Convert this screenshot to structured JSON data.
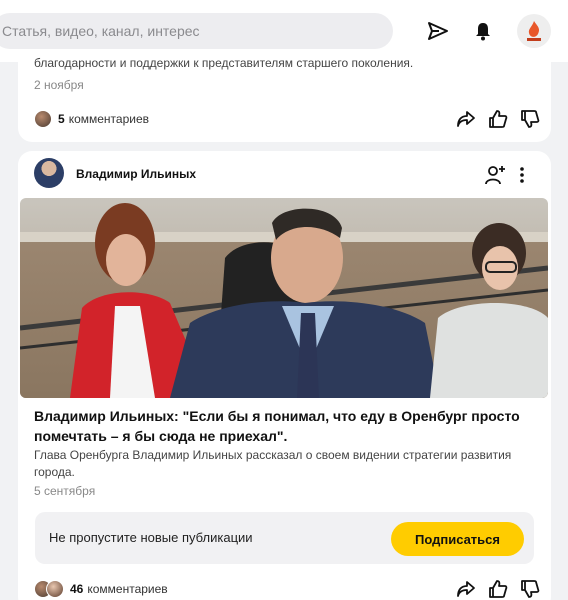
{
  "header": {
    "search_placeholder": "Статья, видео, канал, интерес",
    "icons": [
      "send-icon",
      "bell-icon",
      "profile-avatar"
    ]
  },
  "card1": {
    "snippet": "благодарности и поддержки к представителям старшего поколения.",
    "date": "2 ноября",
    "comments_count": "5",
    "comments_label": "комментариев"
  },
  "card2": {
    "author": "Владимир Ильиных",
    "title": "Владимир Ильиных: \"Если бы я понимал, что еду в Оренбург просто помечтать – я бы сюда не приехал\".",
    "description": "Глава Оренбурга Владимир Ильиных рассказал о своем видении стратегии развития города.",
    "date": "5 сентября",
    "promo_text": "Не пропустите новые публикации",
    "subscribe_label": "Подписаться",
    "comments_count": "46",
    "comments_label": "комментариев"
  },
  "colors": {
    "accent": "#ffcc00",
    "background": "#f1f2f4",
    "card": "#ffffff"
  }
}
